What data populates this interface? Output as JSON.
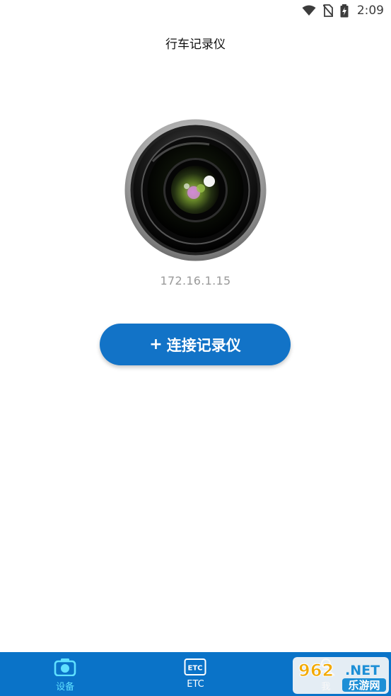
{
  "status_bar": {
    "time": "2:09",
    "icons": [
      "wifi-icon",
      "no-sim-icon",
      "battery-charging-icon"
    ]
  },
  "header": {
    "title": "行车记录仪"
  },
  "device": {
    "image": "camera-lens-icon",
    "ip_address": "172.16.1.15"
  },
  "actions": {
    "connect_label": "连接记录仪",
    "connect_prefix": "+"
  },
  "bottom_nav": {
    "items": [
      {
        "label": "设备",
        "icon": "camera-icon",
        "active": true
      },
      {
        "label": "ETC",
        "icon": "etc-icon",
        "active": false
      },
      {
        "label": "我",
        "icon": "person-icon",
        "active": false
      }
    ]
  },
  "watermark": {
    "text_top": "962.NET",
    "text_bottom": "乐游网"
  },
  "colors": {
    "primary": "#1273c7",
    "nav_background": "#0a73c8",
    "active_tab": "#5fe0ff",
    "ip_text": "#9a9a9a"
  }
}
